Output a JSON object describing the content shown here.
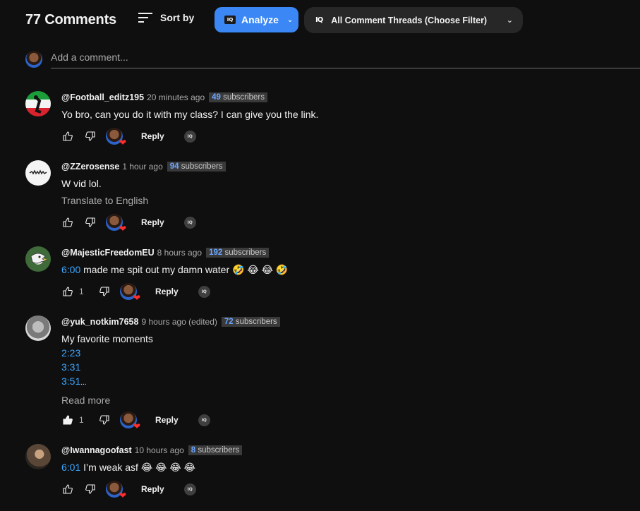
{
  "header": {
    "count_label": "77 Comments",
    "sort_label": "Sort by",
    "analyze_label": "Analyze",
    "filter_label": "All Comment Threads (Choose Filter)",
    "iq_icon_text": "IQ"
  },
  "add_comment": {
    "placeholder": "Add a comment..."
  },
  "actions": {
    "reply_label": "Reply"
  },
  "comments": [
    {
      "author": "@Football_editz195",
      "time": "20 minutes ago",
      "subs_count": "49",
      "subs_label": "subscribers",
      "text": "Yo bro, can you do it with my class? I can give you the link.",
      "likes": ""
    },
    {
      "author": "@ZZerosense",
      "time": "1 hour ago",
      "subs_count": "94",
      "subs_label": "subscribers",
      "text": "W vid lol.",
      "translate": "Translate to English",
      "likes": ""
    },
    {
      "author": "@MajesticFreedomEU",
      "time": "8 hours ago",
      "subs_count": "192",
      "subs_label": "subscribers",
      "timestamp": "6:00",
      "text": " made me spit out my damn water 🤣 😂 😂 🤣",
      "likes": "1"
    },
    {
      "author": "@yuk_notkim7658",
      "time": "9 hours ago (edited)",
      "subs_count": "72",
      "subs_label": "subscribers",
      "text": "My favorite moments",
      "timestamps": [
        "2:23",
        "3:31",
        "3:51"
      ],
      "ellipsis": "...",
      "read_more": "Read more",
      "likes": "1"
    },
    {
      "author": "@Iwannagoofast",
      "time": "10 hours ago",
      "subs_count": "8",
      "subs_label": "subscribers",
      "timestamp": "6:01",
      "text": " I’m weak asf 😂 😂 😂 😂",
      "likes": ""
    }
  ],
  "colors": {
    "background": "#0f0f0f",
    "analyze_button": "#3a87f5",
    "link": "#3ea6ff",
    "subs_number": "#6aa5ff",
    "heart": "#ff2e2e"
  },
  "icons": [
    "sort-icon",
    "iq-icon",
    "chevron-down-icon",
    "thumbs-up-icon",
    "thumbs-down-icon",
    "heart-icon",
    "iq-circle-icon"
  ]
}
